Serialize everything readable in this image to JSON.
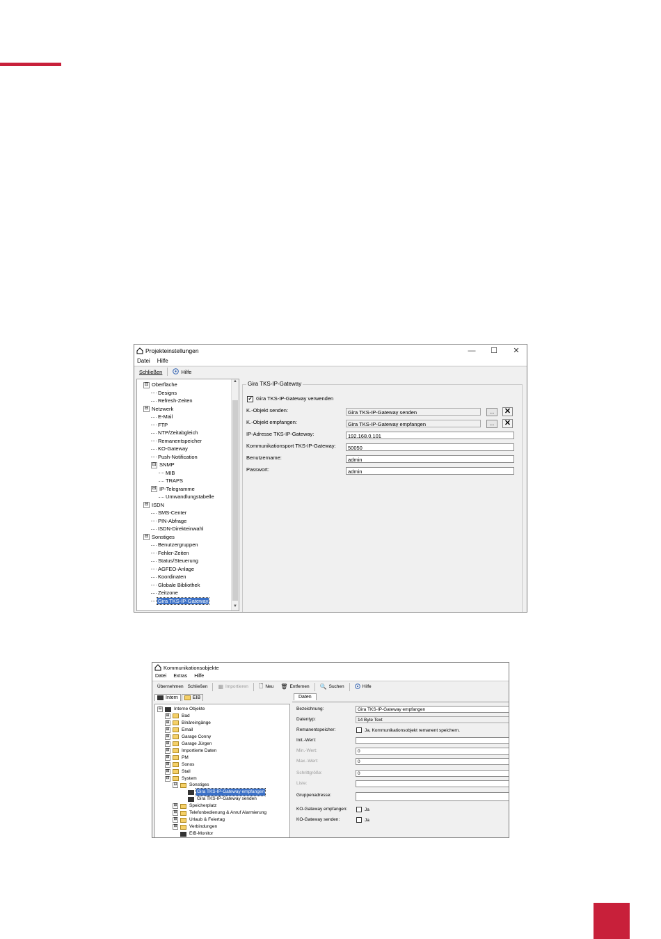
{
  "brand": {
    "accent_color": "#c8203a"
  },
  "window1": {
    "title": "Projekteinstellungen",
    "controls": {
      "minimize": "—",
      "maximize": "☐",
      "close": "✕"
    },
    "menu": [
      "Datei",
      "Hilfe"
    ],
    "toolbar": {
      "close_label": "Schließen",
      "help_label": "Hilfe"
    },
    "tree": [
      {
        "label": "Oberfläche",
        "level": 0,
        "expander": "⊟"
      },
      {
        "label": "Designs",
        "level": 1
      },
      {
        "label": "Refresh-Zeiten",
        "level": 1
      },
      {
        "label": "Netzwerk",
        "level": 0,
        "expander": "⊟"
      },
      {
        "label": "E-Mail",
        "level": 1
      },
      {
        "label": "FTP",
        "level": 1
      },
      {
        "label": "NTP/Zeitabgleich",
        "level": 1
      },
      {
        "label": "Remanentspeicher",
        "level": 1
      },
      {
        "label": "KO-Gateway",
        "level": 1
      },
      {
        "label": "Push-Notification",
        "level": 1
      },
      {
        "label": "SNMP",
        "level": 1,
        "expander": "⊟"
      },
      {
        "label": "MIB",
        "level": 2
      },
      {
        "label": "TRAPS",
        "level": 2
      },
      {
        "label": "IP-Telegramme",
        "level": 1,
        "expander": "⊟"
      },
      {
        "label": "Umwandlungstabelle",
        "level": 2
      },
      {
        "label": "ISDN",
        "level": 0,
        "expander": "⊟"
      },
      {
        "label": "SMS-Center",
        "level": 1
      },
      {
        "label": "PIN-Abfrage",
        "level": 1
      },
      {
        "label": "ISDN-Direkteinwahl",
        "level": 1
      },
      {
        "label": "Sonstiges",
        "level": 0,
        "expander": "⊟"
      },
      {
        "label": "Benutzergruppen",
        "level": 1
      },
      {
        "label": "Fehler-Zeiten",
        "level": 1
      },
      {
        "label": "Status/Steuerung",
        "level": 1
      },
      {
        "label": "AGFEO-Anlage",
        "level": 1
      },
      {
        "label": "Koordinaten",
        "level": 1
      },
      {
        "label": "Globale Bibliothek",
        "level": 1
      },
      {
        "label": "Zeitzone",
        "level": 1
      },
      {
        "label": "Gira TKS-IP-Gateway",
        "level": 1,
        "selected": true
      }
    ],
    "group_title": "Gira TKS-IP-Gateway",
    "use_checkbox": {
      "label": "Gira TKS-IP-Gateway verwenden",
      "checked": true,
      "mark": "✔"
    },
    "fields": {
      "send": {
        "label": "K.-Objekt senden:",
        "value": "Gira TKS-IP-Gateway senden"
      },
      "receive": {
        "label": "K.-Objekt empfangen:",
        "value": "Gira TKS-IP-Gateway empfangen"
      },
      "ip": {
        "label": "IP-Adresse TKS-IP-Gateway:",
        "value": "192.168.0.101"
      },
      "port": {
        "label": "Kommunikationsport TKS-IP-Gateway:",
        "value": "50050"
      },
      "user": {
        "label": "Benutzername:",
        "value": "admin"
      },
      "password": {
        "label": "Passwort:",
        "value": "admin"
      }
    },
    "browse_label": "...",
    "clear_label": "✕"
  },
  "window2": {
    "title": "Kommunikationsobjekte",
    "menu": [
      "Datei",
      "Extras",
      "Hilfe"
    ],
    "toolbar": {
      "apply": "Übernehmen",
      "close": "Schließen",
      "import": "Importieren",
      "new": "Neu",
      "remove": "Entfernen",
      "search": "Suchen",
      "help": "Hilfe"
    },
    "left_tabs": [
      "Intern",
      "EIB"
    ],
    "tree": [
      {
        "label": "Interne Objekte",
        "level": 0,
        "expander": "⊟",
        "icon": "root"
      },
      {
        "label": "Bad",
        "level": 1,
        "expander": "⊞",
        "icon": "folder"
      },
      {
        "label": "Binäreingänge",
        "level": 1,
        "expander": "⊞",
        "icon": "folder"
      },
      {
        "label": "Email",
        "level": 1,
        "expander": "⊞",
        "icon": "folder"
      },
      {
        "label": "Garage Conny",
        "level": 1,
        "expander": "⊞",
        "icon": "folder"
      },
      {
        "label": "Garage Jürgen",
        "level": 1,
        "expander": "⊞",
        "icon": "folder"
      },
      {
        "label": "Importierte Daten",
        "level": 1,
        "expander": "⊞",
        "icon": "folder"
      },
      {
        "label": "PM",
        "level": 1,
        "expander": "⊞",
        "icon": "folder"
      },
      {
        "label": "Sonos",
        "level": 1,
        "expander": "⊞",
        "icon": "folder"
      },
      {
        "label": "Stall",
        "level": 1,
        "expander": "⊞",
        "icon": "folder"
      },
      {
        "label": "System",
        "level": 1,
        "expander": "⊟",
        "icon": "folder"
      },
      {
        "label": "Sonstiges",
        "level": 2,
        "expander": "⊟",
        "icon": "folder"
      },
      {
        "label": "Gira TKS-IP-Gateway empfangen",
        "level": 3,
        "icon": "object",
        "selected": true
      },
      {
        "label": "Gira TKS-IP-Gateway senden",
        "level": 3,
        "icon": "object"
      },
      {
        "label": "Speicherplatz",
        "level": 2,
        "expander": "⊞",
        "icon": "folder"
      },
      {
        "label": "Telefonbedienung & Anruf Alarmierung",
        "level": 2,
        "expander": "⊞",
        "icon": "folder"
      },
      {
        "label": "Urlaub & Feiertag",
        "level": 2,
        "expander": "⊞",
        "icon": "folder"
      },
      {
        "label": "Verbindungen",
        "level": 2,
        "expander": "⊞",
        "icon": "folder"
      },
      {
        "label": "EIB-Monitor",
        "level": 2,
        "icon": "object"
      }
    ],
    "right_tab": "Daten",
    "form": {
      "bezeichnung": {
        "label": "Bezeichnung:",
        "value": "Gira TKS-IP-Gateway empfangen"
      },
      "datentyp": {
        "label": "Datentyp:",
        "value": "14 Byte Text"
      },
      "remanent": {
        "label": "Remanentspeicher:",
        "checkbox": "Ja, Kommunikationsobjekt remanent speichern."
      },
      "init": {
        "label": "Init.-Wert:",
        "value": ""
      },
      "min": {
        "label": "Min.-Wert:",
        "value": "0"
      },
      "max": {
        "label": "Max.-Wert:",
        "value": "0"
      },
      "step": {
        "label": "Schrittgröße:",
        "value": "0"
      },
      "list": {
        "label": "Liste:",
        "value": ""
      },
      "group": {
        "label": "Gruppenadresse:",
        "value": ""
      },
      "ko_recv": {
        "label": "KO-Gateway empfangen:",
        "checkbox": "Ja"
      },
      "ko_send": {
        "label": "KO-Gateway senden:",
        "checkbox": "Ja"
      }
    }
  }
}
